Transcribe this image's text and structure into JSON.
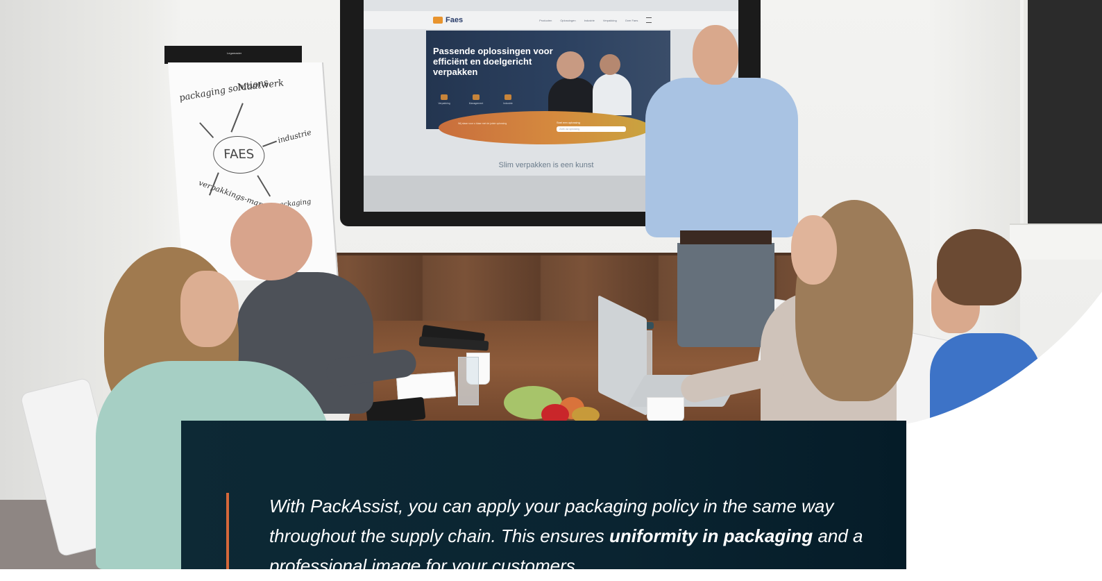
{
  "screen": {
    "logo_text": "Faes",
    "nav_items": [
      "Producten",
      "Oplossingen",
      "Industrie",
      "Verpakking",
      "Over Faes"
    ],
    "hero_title": "Passende oplossingen voor efficiënt en doelgericht verpakken",
    "hero_icons": [
      "Verpakking",
      "Management",
      "Industrie"
    ],
    "band_text": "Wij staan voor u klaar met de juiste oplossing",
    "band_label": "Snel een oplossing",
    "band_placeholder": "Zoek uw oplossing",
    "slogan": "Slim verpakken is een kunst"
  },
  "flipchart": {
    "brand": "Legamaster",
    "words": [
      "packaging solutions",
      "Maatwerk",
      "industrie",
      "verpakkings-management",
      "packaging"
    ],
    "center": "FAES"
  },
  "quote": {
    "part1": "With PackAssist, you can apply your packaging policy in the same way throughout the supply chain. This ensures ",
    "bold": "uniformity in packaging",
    "part2": " and a professional image for your customers."
  },
  "colors": {
    "card_bg": "#0a2431",
    "accent_bar": "#d5683a",
    "text": "#ffffff"
  }
}
